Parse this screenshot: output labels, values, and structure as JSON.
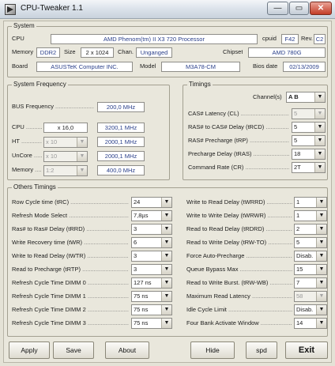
{
  "window": {
    "title": "CPU-Tweaker 1.1",
    "min": "—",
    "max": "▭",
    "close": "✕"
  },
  "system": {
    "group_title": "System",
    "cpu_label": "CPU",
    "cpu_value": "AMD Phenom(tm) II X3 720 Processor",
    "cpuid_label": "cpuid",
    "cpuid_value": "F42",
    "rev_label": "Rev.",
    "rev_value": "C2",
    "memory_label": "Memory",
    "memory_type": "DDR2",
    "size_label": "Size",
    "size_value": "2 x 1024",
    "chan_label": "Chan.",
    "chan_value": "Unganged",
    "chipset_label": "Chipset",
    "chipset_value": "AMD 780G",
    "board_label": "Board",
    "board_value": "ASUSTeK Computer INC.",
    "model_label": "Model",
    "model_value": "M3A78-CM",
    "bios_label": "Bios date",
    "bios_value": "02/13/2009"
  },
  "freq": {
    "group_title": "System Frequency",
    "bus_label": "BUS Frequency",
    "bus_value": "200,0 MHz",
    "cpu_label": "CPU",
    "cpu_mult": "x 16,0",
    "cpu_value": "3200,1 MHz",
    "ht_label": "HT",
    "ht_mult": "x 10",
    "ht_value": "2000,1 MHz",
    "uncore_label": "UnCore",
    "uncore_mult": "x 10",
    "uncore_value": "2000,1 MHz",
    "memory_label": "Memory",
    "memory_ratio": "1:2",
    "memory_value": "400,0 MHz"
  },
  "timings": {
    "group_title": "Timings",
    "channels_label": "Channel(s)",
    "channels_value": "A  B",
    "rows": [
      {
        "label": "CAS# Latency (CL)",
        "value": "5"
      },
      {
        "label": "RAS# to CAS# Delay (tRCD)",
        "value": "5"
      },
      {
        "label": "RAS# Precharge (tRP)",
        "value": "5"
      },
      {
        "label": "Precharge Delay (tRAS)",
        "value": "18"
      },
      {
        "label": "Command Rate (CR)",
        "value": "2T"
      }
    ]
  },
  "others": {
    "group_title": "Others Timings",
    "left": [
      {
        "label": "Row Cycle time (tRC)",
        "value": "24"
      },
      {
        "label": "Refresh Mode Select",
        "value": "7,8µs"
      },
      {
        "label": "Ras# to Ras# Delay (tRRD)",
        "value": "3"
      },
      {
        "label": "Write Recovery time (tWR)",
        "value": "6"
      },
      {
        "label": "Write to Read Delay (tWTR)",
        "value": "3"
      },
      {
        "label": "Read to Precharge (tRTP)",
        "value": "3"
      },
      {
        "label": "Refresh Cycle Time  DIMM 0",
        "value": "127 ns"
      },
      {
        "label": "Refresh Cycle Time  DIMM 1",
        "value": "75 ns"
      },
      {
        "label": "Refresh Cycle Time  DIMM 2",
        "value": "75 ns"
      },
      {
        "label": "Refresh Cycle Time  DIMM 3",
        "value": "75 ns"
      }
    ],
    "right": [
      {
        "label": "Write to Read Delay (tWRRD)",
        "value": "1"
      },
      {
        "label": "Write to Write Delay (tWRWR)",
        "value": "1"
      },
      {
        "label": "Read to Read Delay (tRDRD)",
        "value": "2"
      },
      {
        "label": "Read to Write Delay (tRW-TO)",
        "value": "5"
      },
      {
        "label": "Force Auto-Precharge",
        "value": "Disab."
      },
      {
        "label": "Queue Bypass Max",
        "value": "15"
      },
      {
        "label": "Read to Write Burst. (tRW-WB)",
        "value": "7"
      },
      {
        "label": "Maximum Read Latency",
        "value": "58"
      },
      {
        "label": "Idle Cycle Limit",
        "value": "Disab."
      },
      {
        "label": "Four Bank Activate Window",
        "value": "14"
      }
    ]
  },
  "buttons": {
    "apply": "Apply",
    "save": "Save",
    "about": "About",
    "hide": "Hide",
    "spd": "spd",
    "exit": "Exit"
  },
  "icons": {
    "dropdown": "▼"
  }
}
